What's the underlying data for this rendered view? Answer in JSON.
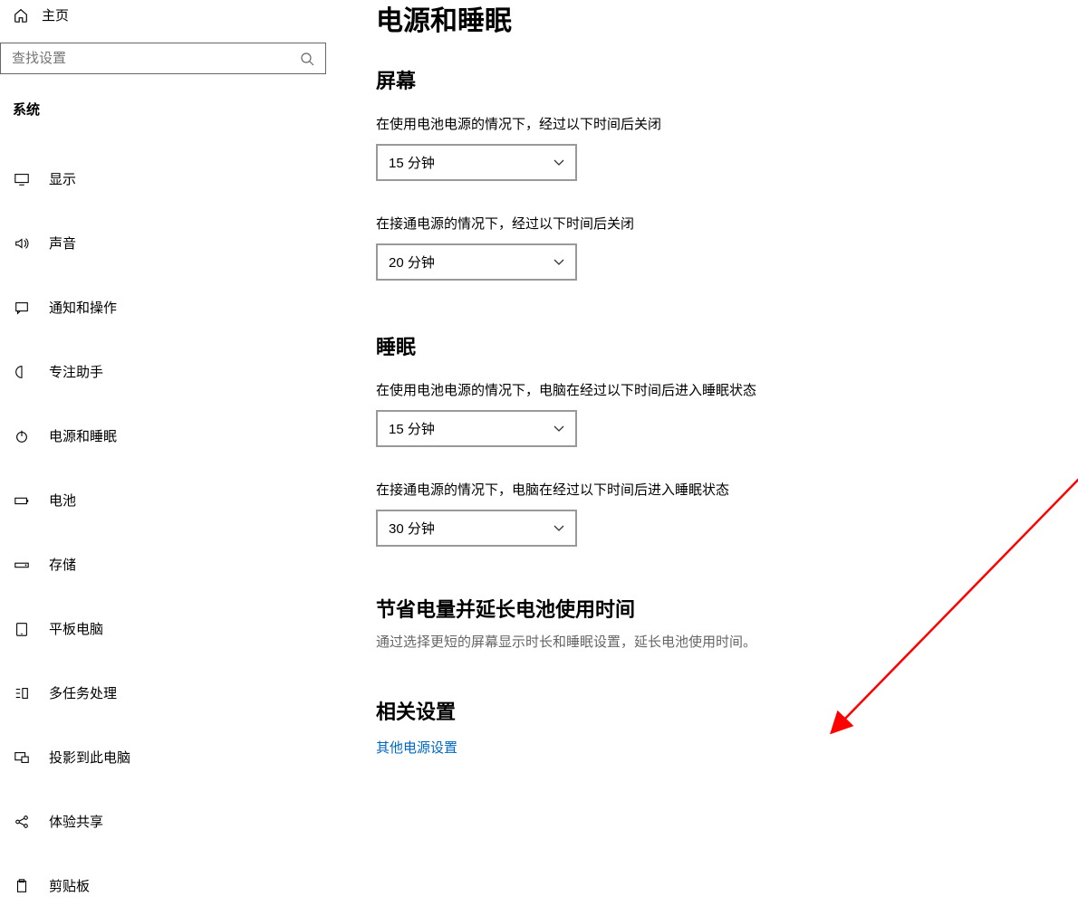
{
  "sidebar": {
    "home_label": "主页",
    "search_placeholder": "查找设置",
    "category_label": "系统",
    "items": [
      {
        "label": "显示",
        "icon": "display-icon"
      },
      {
        "label": "声音",
        "icon": "sound-icon"
      },
      {
        "label": "通知和操作",
        "icon": "notification-icon"
      },
      {
        "label": "专注助手",
        "icon": "focus-icon"
      },
      {
        "label": "电源和睡眠",
        "icon": "power-icon"
      },
      {
        "label": "电池",
        "icon": "battery-icon"
      },
      {
        "label": "存储",
        "icon": "storage-icon"
      },
      {
        "label": "平板电脑",
        "icon": "tablet-icon"
      },
      {
        "label": "多任务处理",
        "icon": "multitask-icon"
      },
      {
        "label": "投影到此电脑",
        "icon": "project-icon"
      },
      {
        "label": "体验共享",
        "icon": "share-icon"
      },
      {
        "label": "剪贴板",
        "icon": "clipboard-icon"
      }
    ]
  },
  "main": {
    "page_title": "电源和睡眠",
    "screen": {
      "title": "屏幕",
      "battery_label": "在使用电池电源的情况下，经过以下时间后关闭",
      "battery_value": "15 分钟",
      "plugged_label": "在接通电源的情况下，经过以下时间后关闭",
      "plugged_value": "20 分钟"
    },
    "sleep": {
      "title": "睡眠",
      "battery_label": "在使用电池电源的情况下，电脑在经过以下时间后进入睡眠状态",
      "battery_value": "15 分钟",
      "plugged_label": "在接通电源的情况下，电脑在经过以下时间后进入睡眠状态",
      "plugged_value": "30 分钟"
    },
    "save_power": {
      "title": "节省电量并延长电池使用时间",
      "text": "通过选择更短的屏幕显示时长和睡眠设置，延长电池使用时间。"
    },
    "related": {
      "title": "相关设置",
      "link": "其他电源设置"
    }
  }
}
